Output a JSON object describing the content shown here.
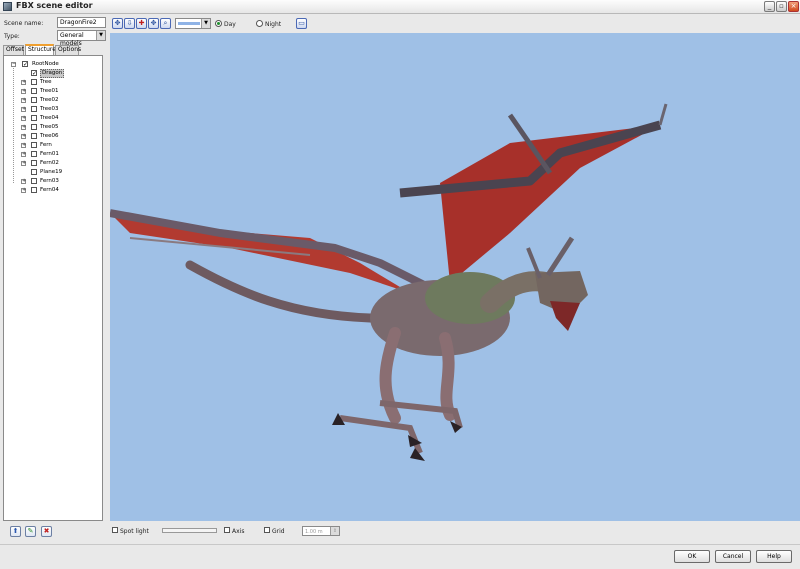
{
  "window": {
    "title": "FBX scene editor",
    "icon": "fbx-app-icon"
  },
  "properties": {
    "scene_name_label": "Scene name:",
    "scene_name_value": "DragonFire2",
    "type_label": "Type:",
    "type_value": "General models"
  },
  "tabs": [
    {
      "label": "Offset"
    },
    {
      "label": "Structure",
      "active": true
    },
    {
      "label": "Options"
    }
  ],
  "tree": {
    "root": "RootNode",
    "items": [
      {
        "label": "Dragon",
        "checked": true,
        "selected": true,
        "expandable": false
      },
      {
        "label": "Tree",
        "checked": false,
        "expandable": true
      },
      {
        "label": "Tree01",
        "checked": false,
        "expandable": true
      },
      {
        "label": "Tree02",
        "checked": false,
        "expandable": true
      },
      {
        "label": "Tree03",
        "checked": false,
        "expandable": true
      },
      {
        "label": "Tree04",
        "checked": false,
        "expandable": true
      },
      {
        "label": "Tree05",
        "checked": false,
        "expandable": true
      },
      {
        "label": "Tree06",
        "checked": false,
        "expandable": true
      },
      {
        "label": "Fern",
        "checked": false,
        "expandable": true
      },
      {
        "label": "Fern01",
        "checked": false,
        "expandable": true
      },
      {
        "label": "Fern02",
        "checked": false,
        "expandable": true
      },
      {
        "label": "Plane19",
        "checked": false,
        "expandable": false
      },
      {
        "label": "Fern03",
        "checked": false,
        "expandable": true
      },
      {
        "label": "Fern04",
        "checked": false,
        "expandable": true
      }
    ]
  },
  "toolbar": {
    "day_label": "Day",
    "night_label": "Night",
    "mode": "Day"
  },
  "viewport_options": {
    "spot_light_label": "Spot light",
    "axis_label": "Axis",
    "grid_label": "Grid",
    "grid_size": "1.00 m"
  },
  "dialog_buttons": {
    "ok": "OK",
    "cancel": "Cancel",
    "help": "Help"
  },
  "colors": {
    "viewport_background": "#9fc0e6",
    "tab_accent": "#f0a030",
    "day_radio": "#1f8f2f"
  }
}
